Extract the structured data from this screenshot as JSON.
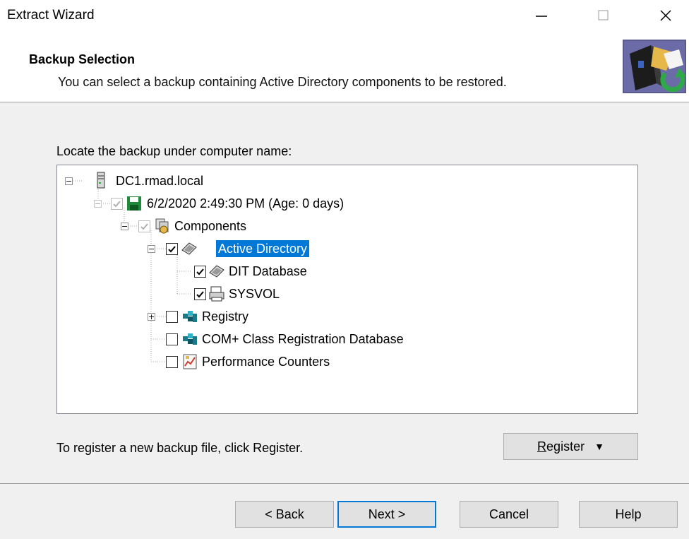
{
  "window": {
    "title": "Extract Wizard",
    "controls": {
      "minimize_icon": "minimize-icon",
      "maximize_icon": "maximize-icon",
      "close_icon": "close-icon"
    }
  },
  "header": {
    "title": "Backup Selection",
    "subtitle": "You can select a backup containing Active Directory components to be restored.",
    "icon": "backup-restore-icon"
  },
  "main": {
    "locate_label": "Locate the backup under computer name:",
    "tree": [
      {
        "label": "DC1.rmad.local",
        "icon": "server-icon",
        "checkbox": null,
        "expander": "minus"
      },
      {
        "label": "6/2/2020 2:49:30 PM (Age: 0 days)",
        "icon": "save-disk-icon",
        "checkbox": "checked-dim",
        "expander": "minus-dim"
      },
      {
        "label": "Components",
        "icon": "components-icon",
        "checkbox": "checked-dim",
        "expander": "minus"
      },
      {
        "label": "Active Directory",
        "icon": "directory-icon",
        "checkbox": "checked",
        "expander": "minus",
        "selected": true
      },
      {
        "label": "DIT Database",
        "icon": "database-icon",
        "checkbox": "checked",
        "expander": null
      },
      {
        "label": "SYSVOL",
        "icon": "sysvol-icon",
        "checkbox": "checked",
        "expander": null
      },
      {
        "label": "Registry",
        "icon": "registry-icon",
        "checkbox": "unchecked",
        "expander": "plus"
      },
      {
        "label": "COM+ Class Registration Database",
        "icon": "com-registry-icon",
        "checkbox": "unchecked",
        "expander": null
      },
      {
        "label": "Performance Counters",
        "icon": "performance-icon",
        "checkbox": "unchecked",
        "expander": null
      }
    ],
    "register_text": "To register a new backup file, click Register.",
    "register_button": {
      "label_prefix": "",
      "label_underlined": "R",
      "label_rest": "egister",
      "arrow": "▼"
    }
  },
  "footer": {
    "back": "< Back",
    "next": "Next >",
    "cancel": "Cancel",
    "help": "Help"
  },
  "colors": {
    "selection": "#0078d7",
    "accent": "#0078d7"
  }
}
